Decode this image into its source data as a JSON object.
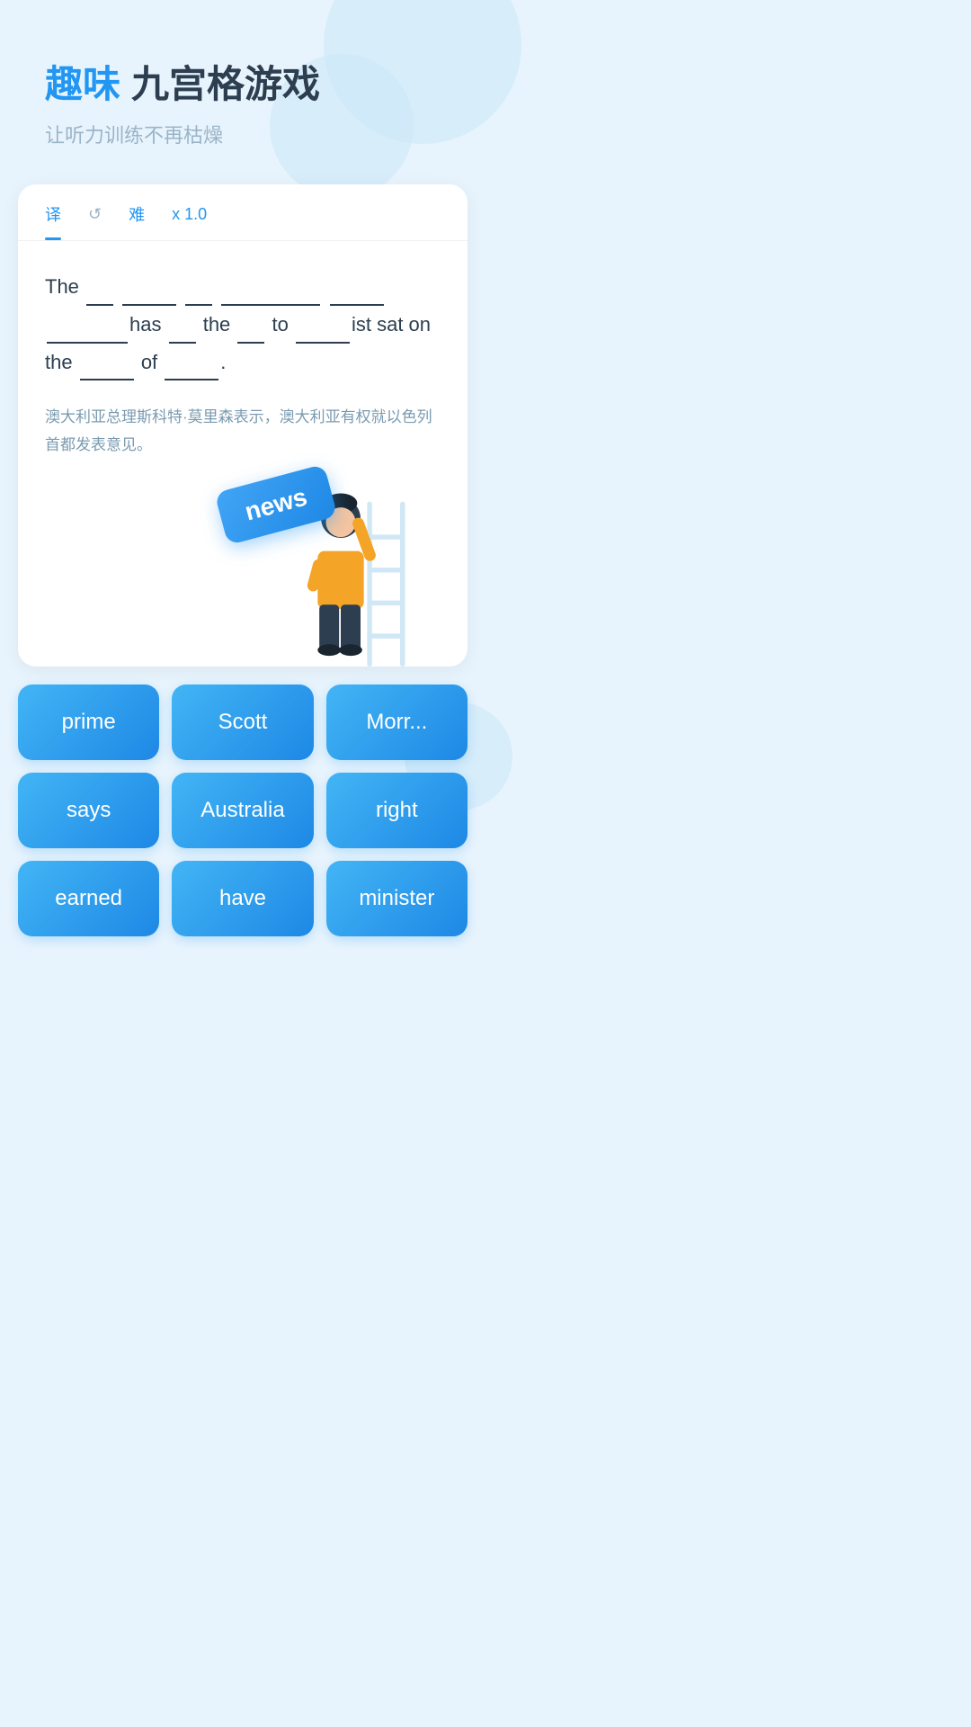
{
  "header": {
    "title_fun": "趣味",
    "title_main": "九宫格游戏",
    "subtitle": "让听力训练不再枯燥"
  },
  "tabs": [
    {
      "id": "translate",
      "label": "译",
      "active": true
    },
    {
      "id": "refresh",
      "label": "↺",
      "active": false
    },
    {
      "id": "level",
      "label": "难",
      "active": false
    },
    {
      "id": "speed",
      "label": "x 1.0",
      "active": false
    }
  ],
  "sentence": {
    "display": "The ___ ______ ___ __________ _____ ________has ___ the ___ to _____ist sat on the ____ of ___.",
    "translation": "澳大利亚总理斯科特·莫里森表示，澳大利亚有权就以色列首都发表意见。"
  },
  "floating_word": "news",
  "words": [
    {
      "id": "prime",
      "label": "prime"
    },
    {
      "id": "scott",
      "label": "Scott"
    },
    {
      "id": "morrison",
      "label": "Morr..."
    },
    {
      "id": "says",
      "label": "says"
    },
    {
      "id": "australia",
      "label": "Australia"
    },
    {
      "id": "right",
      "label": "right"
    },
    {
      "id": "earned",
      "label": "earned"
    },
    {
      "id": "have",
      "label": "have"
    },
    {
      "id": "minister",
      "label": "minister"
    }
  ]
}
